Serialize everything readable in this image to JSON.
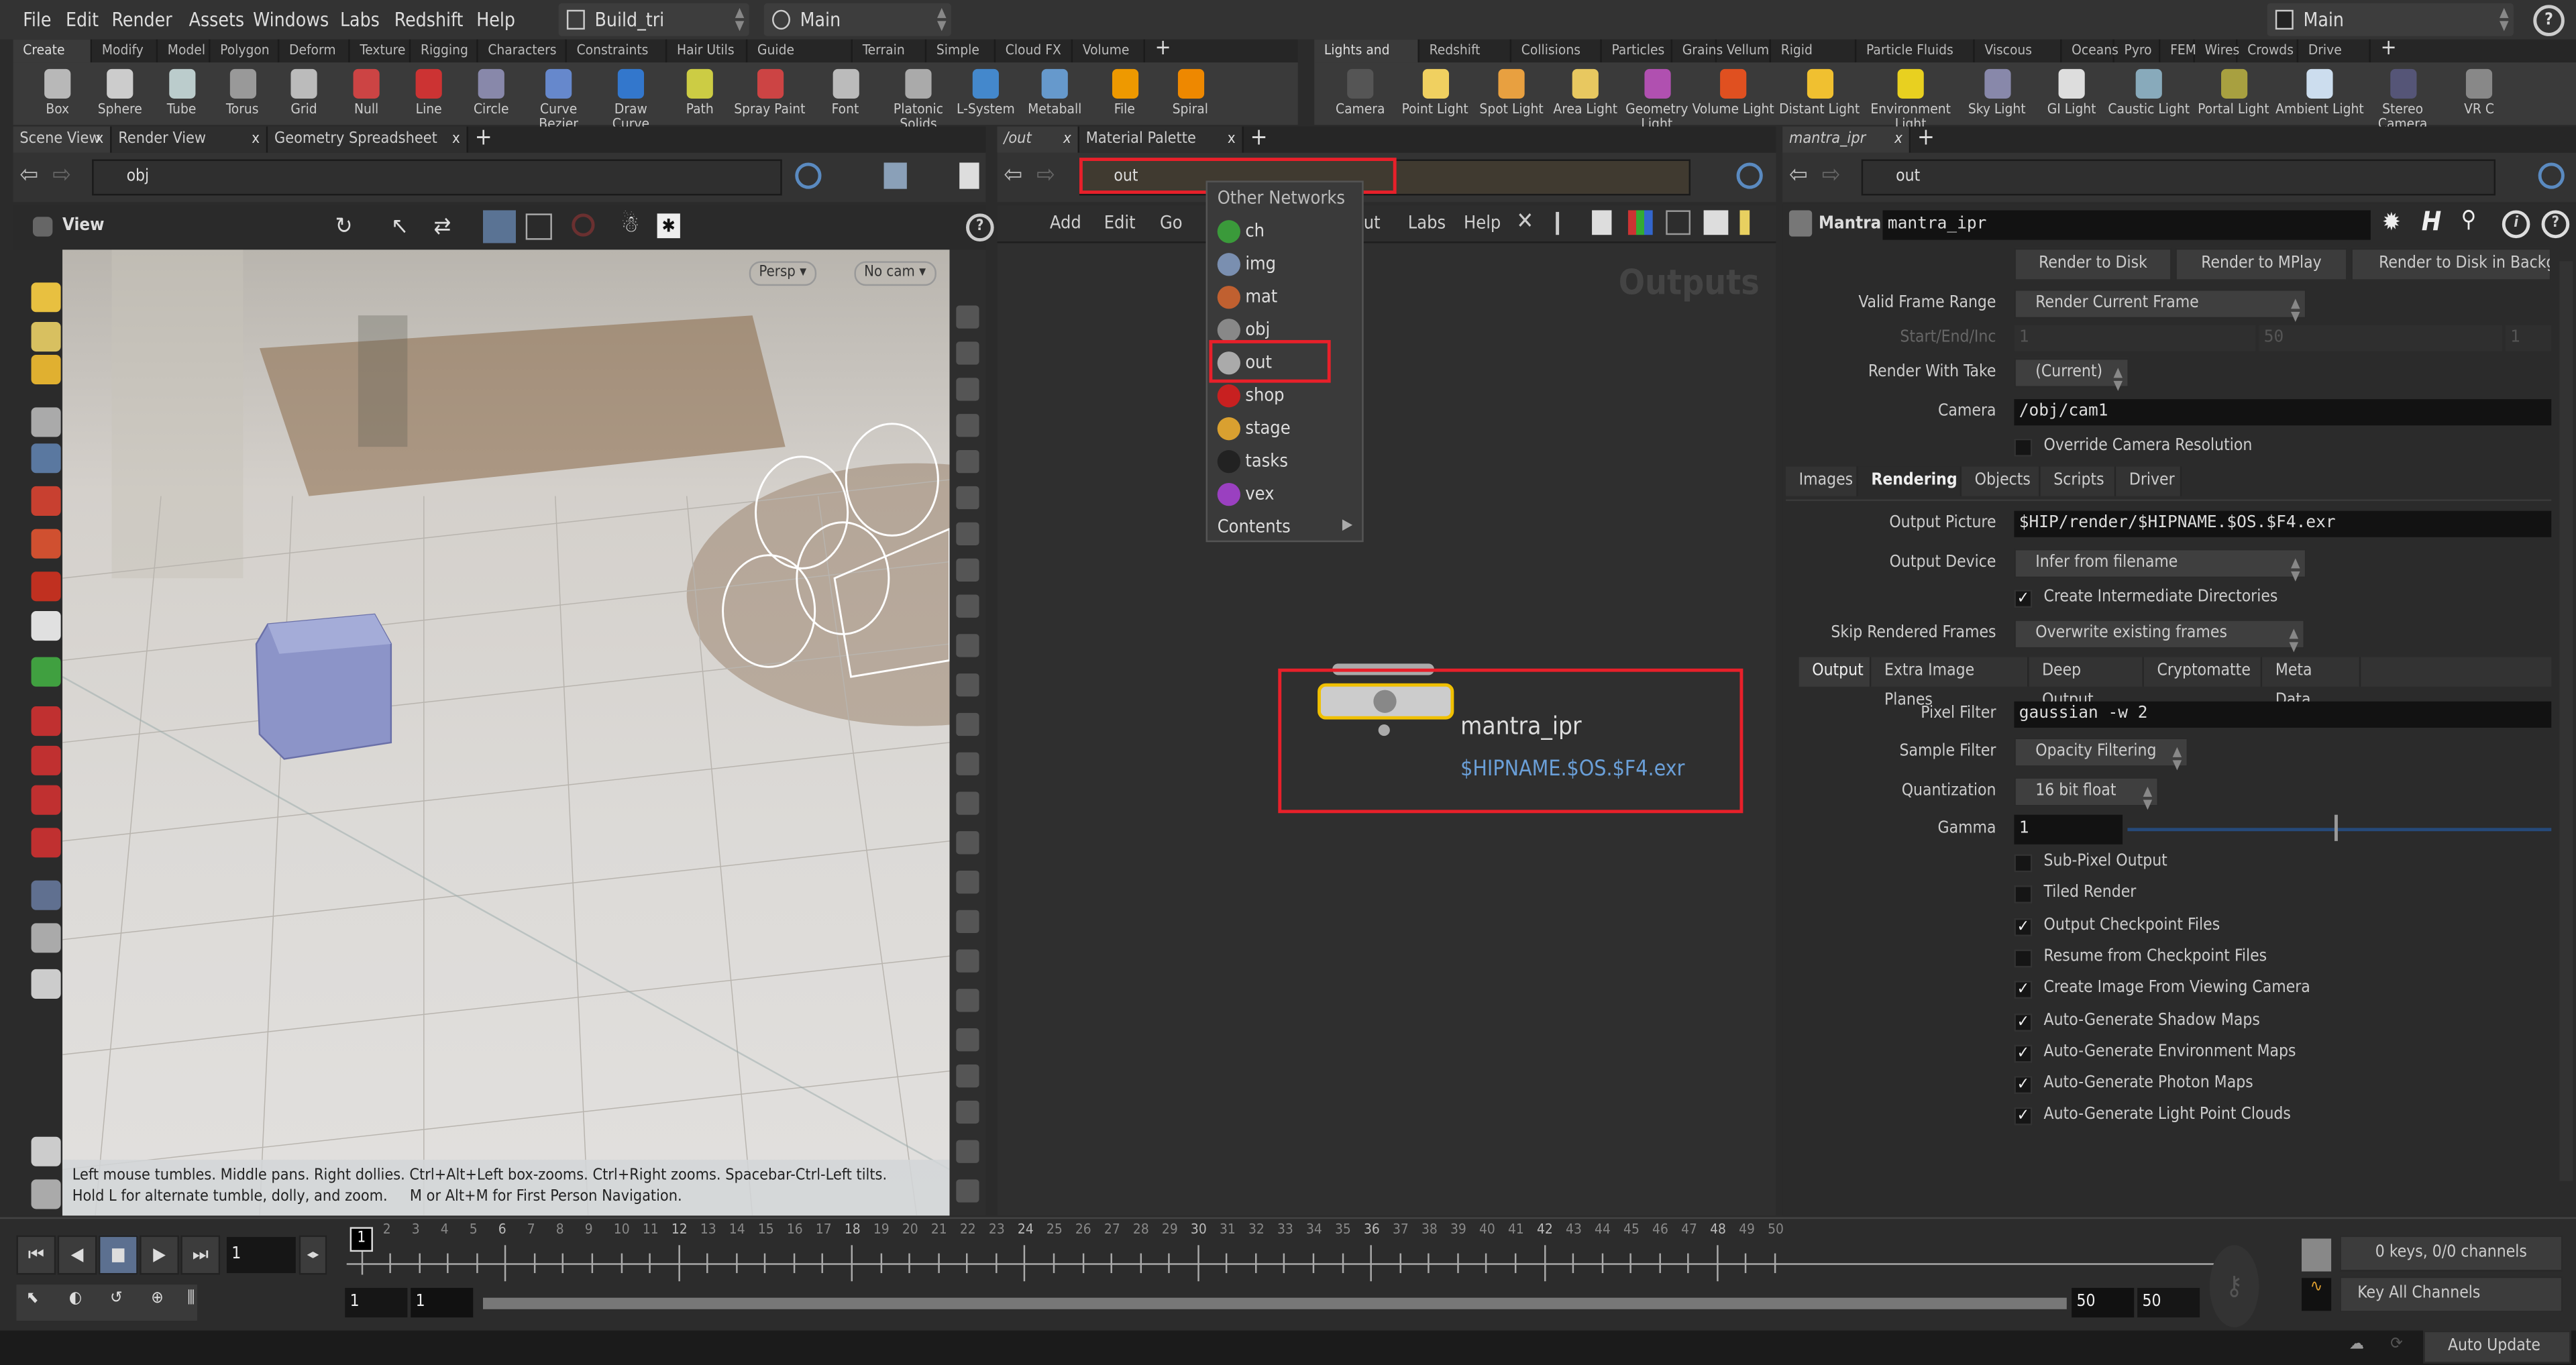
{
  "menubar": {
    "items": [
      "File",
      "Edit",
      "Render",
      "Assets",
      "Windows",
      "Labs",
      "Redshift",
      "Help"
    ],
    "desktop": "Build_tri",
    "context": "Main",
    "take": "Main",
    "help_icon": "help-icon"
  },
  "shelf_left": {
    "tabs": [
      "Create",
      "Modify",
      "Model",
      "Polygon",
      "Deform",
      "Texture",
      "Rigging",
      "Characters",
      "Constraints",
      "Hair Utils",
      "Guide Process",
      "Terrain FX",
      "Simple FX",
      "Cloud FX",
      "Volume"
    ],
    "tools": [
      "Box",
      "Sphere",
      "Tube",
      "Torus",
      "Grid",
      "Null",
      "Line",
      "Circle",
      "Curve Bezier",
      "Draw Curve",
      "Path",
      "Spray Paint",
      "Font",
      "Platonic Solids",
      "L-System",
      "Metaball",
      "File",
      "Spiral"
    ]
  },
  "shelf_right": {
    "tabs": [
      "Lights and C...",
      "Redshift",
      "Collisions",
      "Particles",
      "Grains",
      "Vellum",
      "Rigid Bodies",
      "Particle Fluids",
      "Viscous Fluids",
      "Oceans",
      "Pyro FX",
      "FEM",
      "Wires",
      "Crowds",
      "Drive Simula..."
    ],
    "tools": [
      "Camera",
      "Point Light",
      "Spot Light",
      "Area Light",
      "Geometry Light",
      "Volume Light",
      "Distant Light",
      "Environment Light",
      "Sky Light",
      "GI Light",
      "Caustic Light",
      "Portal Light",
      "Ambient Light",
      "Stereo Camera",
      "VR C"
    ]
  },
  "scene_pane": {
    "tabs": [
      "Scene View",
      "Render View",
      "Geometry Spreadsheet"
    ],
    "path": "obj",
    "view_label": "View",
    "persp": "Persp",
    "cam": "No cam",
    "hint_line1": "Left mouse tumbles. Middle pans. Right dollies. Ctrl+Alt+Left box-zooms. Ctrl+Right zooms. Spacebar-Ctrl-Left tilts.",
    "hint_line2": "Hold L for alternate tumble, dolly, and zoom.     M or Alt+M for First Person Navigation."
  },
  "network_pane": {
    "tabs": [
      "/out",
      "Material Palette"
    ],
    "path": "out",
    "menu": [
      "Add",
      "Edit",
      "Go",
      "V",
      "out",
      "Labs",
      "Help"
    ],
    "watermark": "Outputs",
    "dropdown": {
      "header": "Other Networks",
      "items": [
        {
          "label": "ch",
          "color": "#3a9a3a"
        },
        {
          "label": "img",
          "color": "#7a8fb0"
        },
        {
          "label": "mat",
          "color": "#c06030"
        },
        {
          "label": "obj",
          "color": "#888888"
        },
        {
          "label": "out",
          "color": "#aaaaaa"
        },
        {
          "label": "shop",
          "color": "#c82020"
        },
        {
          "label": "stage",
          "color": "#d9a030"
        },
        {
          "label": "tasks",
          "color": "#222222"
        },
        {
          "label": "vex",
          "color": "#9a40c0"
        }
      ],
      "footer": "Contents",
      "selected": "out"
    },
    "node": {
      "name": "mantra_ipr",
      "output": "$HIPNAME.$OS.$F4.exr",
      "highlight": "#f0c000",
      "output_color": "#6a9fd8"
    }
  },
  "params_pane": {
    "tab": "mantra_ipr",
    "path": "out",
    "node_type": "Mantra",
    "node_name": "mantra_ipr",
    "buttons": [
      "Render to Disk",
      "Render to MPlay",
      "Render to Disk in Backg"
    ],
    "valid_frame_range": {
      "label": "Valid Frame Range",
      "value": "Render Current Frame"
    },
    "start_end_inc": {
      "label": "Start/End/Inc",
      "values": [
        "1",
        "50",
        "1"
      ]
    },
    "render_with_take": {
      "label": "Render With Take",
      "value": "(Current)"
    },
    "camera": {
      "label": "Camera",
      "value": "/obj/cam1"
    },
    "override_res": {
      "label": "Override Camera Resolution",
      "checked": false
    },
    "tabs": [
      "Images",
      "Rendering",
      "Objects",
      "Scripts",
      "Driver"
    ],
    "active_tab": "Rendering",
    "output_picture": {
      "label": "Output Picture",
      "value": "$HIP/render/$HIPNAME.$OS.$F4.exr"
    },
    "output_device": {
      "label": "Output Device",
      "value": "Infer from filename"
    },
    "create_dirs": {
      "label": "Create Intermediate Directories",
      "checked": true
    },
    "skip_frames": {
      "label": "Skip Rendered Frames",
      "value": "Overwrite existing frames"
    },
    "subtabs": [
      "Output",
      "Extra Image Planes",
      "Deep Output",
      "Cryptomatte",
      "Meta Data"
    ],
    "pixel_filter": {
      "label": "Pixel Filter",
      "value": "gaussian -w 2"
    },
    "sample_filter": {
      "label": "Sample Filter",
      "value": "Opacity Filtering"
    },
    "quantization": {
      "label": "Quantization",
      "value": "16 bit float"
    },
    "gamma": {
      "label": "Gamma",
      "value": "1"
    },
    "checkboxes": [
      {
        "label": "Sub-Pixel Output",
        "checked": false
      },
      {
        "label": "Tiled Render",
        "checked": false
      },
      {
        "label": "Output Checkpoint Files",
        "checked": true
      },
      {
        "label": "Resume from Checkpoint Files",
        "checked": false
      },
      {
        "label": "Create Image From Viewing Camera",
        "checked": true
      },
      {
        "label": "Auto-Generate Shadow Maps",
        "checked": true
      },
      {
        "label": "Auto-Generate Environment Maps",
        "checked": true
      },
      {
        "label": "Auto-Generate Photon Maps",
        "checked": true
      },
      {
        "label": "Auto-Generate Light Point Clouds",
        "checked": true
      }
    ]
  },
  "timeline": {
    "current_frame": "1",
    "frame_field": "1",
    "ticks": [
      "2",
      "3",
      "4",
      "5",
      "6",
      "7",
      "8",
      "9",
      "10",
      "11",
      "12",
      "13",
      "14",
      "15",
      "16",
      "17",
      "18",
      "19",
      "20",
      "21",
      "22",
      "23",
      "24",
      "25",
      "26",
      "27",
      "28",
      "29",
      "30",
      "31",
      "32",
      "33",
      "34",
      "35",
      "36",
      "37",
      "38",
      "39",
      "40",
      "41",
      "42",
      "43",
      "44",
      "45",
      "46",
      "47",
      "48",
      "49",
      "50"
    ],
    "range_start": "1",
    "range_start2": "1",
    "range_end": "50",
    "range_end2": "50",
    "keys_status": "0 keys, 0/0 channels",
    "key_all": "Key All Channels",
    "auto_update": "Auto Update"
  }
}
